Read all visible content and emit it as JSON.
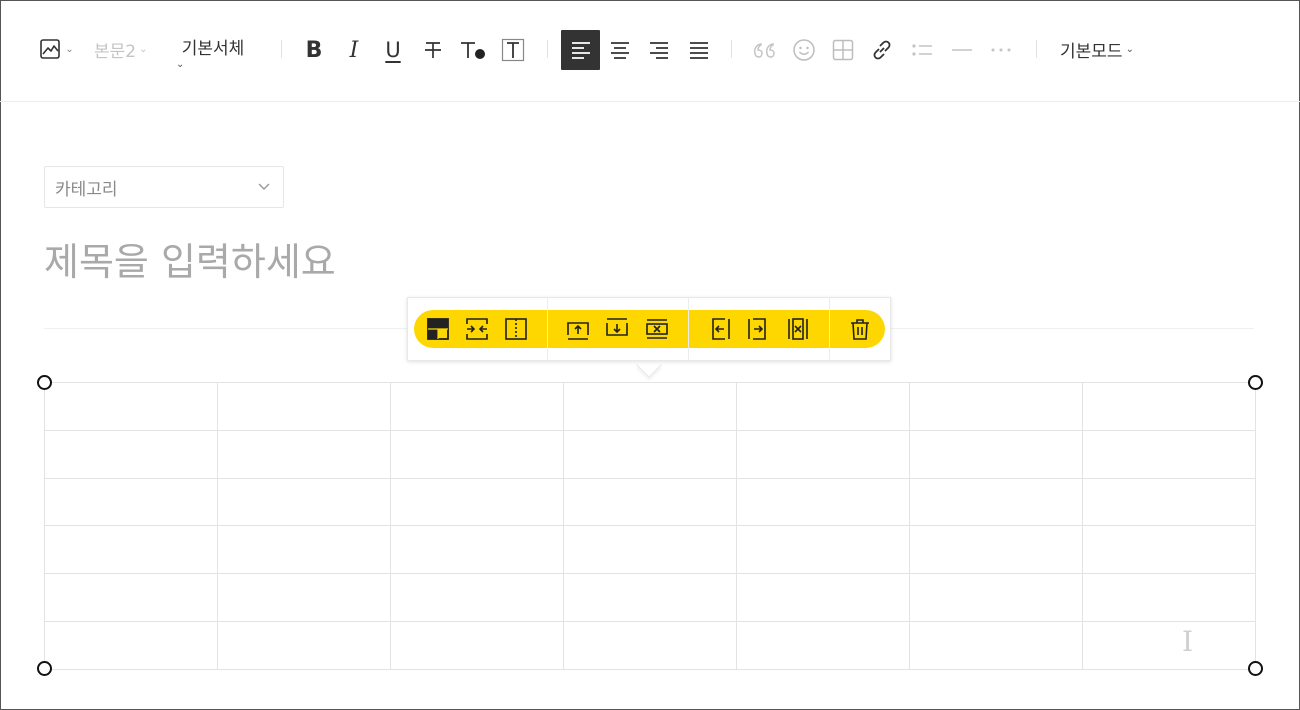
{
  "toolbar": {
    "image_icon": "image-icon",
    "paragraph_style": "본문2",
    "font_family": "기본서체",
    "buttons": {
      "bold": "B",
      "italic": "I",
      "underline": "U"
    },
    "mode_label": "기본모드"
  },
  "editor": {
    "category_label": "카테고리",
    "title_placeholder": "제목을 입력하세요"
  },
  "table_toolbar": {
    "accent_color": "#ffd700",
    "groups": [
      [
        "merge-cells-icon",
        "split-horizontal-icon",
        "split-vertical-icon"
      ],
      [
        "insert-row-above-icon",
        "insert-row-below-icon",
        "delete-row-icon"
      ],
      [
        "insert-column-left-icon",
        "insert-column-right-icon",
        "delete-column-icon"
      ],
      [
        "delete-table-icon"
      ]
    ]
  },
  "table": {
    "rows": 6,
    "columns": 7
  }
}
